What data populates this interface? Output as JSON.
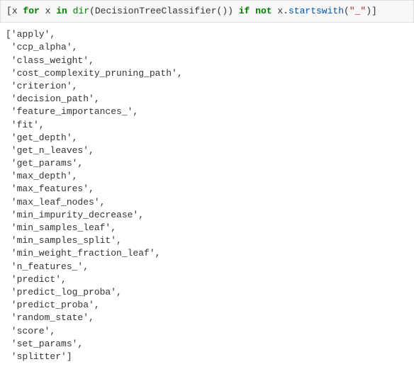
{
  "code": {
    "bracket_open": "[",
    "x1": "x ",
    "for": "for",
    "x2": " x ",
    "in": "in",
    "space1": " ",
    "dir": "dir",
    "paren_open": "(",
    "classname": "DecisionTreeClassifier",
    "call": "()",
    "paren_close": ")",
    "space2": " ",
    "if": "if",
    "space3": " ",
    "not": "not",
    "space4": " x.",
    "startswith": "startswith",
    "paren_open2": "(",
    "string": "\"_\"",
    "paren_close2": ")",
    "bracket_close": "]"
  },
  "output": {
    "items": [
      "'apply'",
      "'ccp_alpha'",
      "'class_weight'",
      "'cost_complexity_pruning_path'",
      "'criterion'",
      "'decision_path'",
      "'feature_importances_'",
      "'fit'",
      "'get_depth'",
      "'get_n_leaves'",
      "'get_params'",
      "'max_depth'",
      "'max_features'",
      "'max_leaf_nodes'",
      "'min_impurity_decrease'",
      "'min_samples_leaf'",
      "'min_samples_split'",
      "'min_weight_fraction_leaf'",
      "'n_features_'",
      "'predict'",
      "'predict_log_proba'",
      "'predict_proba'",
      "'random_state'",
      "'score'",
      "'set_params'",
      "'splitter'"
    ]
  }
}
